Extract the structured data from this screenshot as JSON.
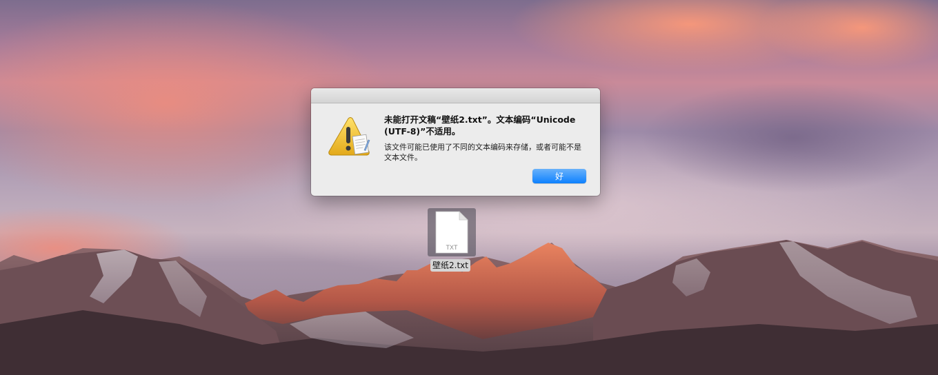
{
  "alert": {
    "title": "未能打开文稿“壁纸2.txt”。文本编码“Unicode (UTF-8)”不适用。",
    "message": "该文件可能已使用了不同的文本编码来存储，或者可能不是文本文件。",
    "ok_label": "好",
    "icon": "warning-icon",
    "button_color": "#1a87fe"
  },
  "desktop": {
    "file": {
      "name": "壁纸2.txt",
      "type_label": "TXT",
      "icon": "txt-document-icon"
    }
  }
}
